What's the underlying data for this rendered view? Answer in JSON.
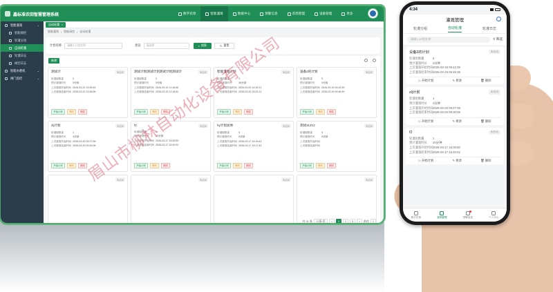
{
  "desktop": {
    "app_title": "鑫标准农田智慧管理系统",
    "topnav": [
      {
        "label": "数字农场",
        "active": false
      },
      {
        "label": "智能灌溉",
        "active": true
      },
      {
        "label": "数据中心",
        "active": false
      },
      {
        "label": "预警信息",
        "active": false
      },
      {
        "label": "农场管理",
        "active": false
      },
      {
        "label": "设备管理",
        "active": false
      },
      {
        "label": "更多",
        "active": false
      }
    ],
    "sidebar": [
      {
        "label": "智能灌溉",
        "type": "group"
      },
      {
        "label": "智能阀控",
        "type": "sub"
      },
      {
        "label": "轮灌分组",
        "type": "sub"
      },
      {
        "label": "自动轮灌",
        "type": "sub",
        "active": true
      },
      {
        "label": "轮灌日志",
        "type": "sub"
      },
      {
        "label": "阀控日志",
        "type": "sub"
      },
      {
        "label": "智能水肥机",
        "type": "group"
      },
      {
        "label": "闸门监控",
        "type": "group"
      }
    ],
    "tab_label": "自动轮灌",
    "breadcrumb": [
      "智能灌溉",
      "智能阀控",
      "自动轮灌"
    ],
    "filter": {
      "name_label": "计划名称",
      "name_placeholder": "请输入计划名称",
      "status_label": "状态",
      "status_placeholder": "请选择",
      "search_label": "搜索",
      "reset_label": "重置"
    },
    "add_label": "新增",
    "field_labels": {
      "count": "轮灌组数量",
      "duration": "预计灌溉时长",
      "last_start": "上次灌溉开始时间",
      "last_end": "上次灌溉结束时间"
    },
    "action_labels": {
      "start": "开始计划",
      "edit": "修改",
      "delete": "删除"
    },
    "cards": [
      {
        "name": "测试计",
        "status": "未启动",
        "count": "2",
        "duration": "0分钟",
        "last_start": "2026-03-20 13:35:45",
        "last_end": "2026-03-20 13:36:06"
      },
      {
        "name": "测试计划测试计划测试计划测试计",
        "status": "未启动",
        "count": "0",
        "duration": "0分钟",
        "last_start": "2026-03-19 11:18:48",
        "last_end": "2026-03-19 11:18:52"
      },
      {
        "name": "智能灌溉计划",
        "status": "未启动",
        "count": "3",
        "duration": "36分钟",
        "last_start": "2026-03-20 14:15:11",
        "last_end": "2026-03-20 15:22:12"
      },
      {
        "name": "设备2的计划",
        "status": "未启动",
        "count": "5",
        "duration": "0分钟",
        "last_start": "2026-03-19 09:42:39",
        "last_end": "2026-03-19 09:46:39"
      },
      {
        "name": "zlj计划",
        "status": "未启动",
        "count": "1",
        "duration": "3分钟",
        "last_start": "2026-03-20 09:27:08",
        "last_end": "2026-03-20 09:30:08"
      },
      {
        "name": "f2",
        "status": "未启动",
        "count": "1",
        "duration": "20分钟",
        "last_start": "2026-03-17 15:39:50",
        "last_end": "2026-03-17 15:40:02"
      },
      {
        "name": "hy计划总体",
        "status": "未启动",
        "count": "0",
        "duration": "0分钟",
        "last_start": "2026-03-17 16:15:43",
        "last_end": "2026-03-17 16:17:43"
      },
      {
        "name": "测试11212",
        "status": "未启动",
        "count": "0",
        "duration": "0分钟",
        "last_start": "",
        "last_end": ""
      },
      {
        "name": "",
        "status": "未启动",
        "count": "",
        "duration": "",
        "last_start": "",
        "last_end": ""
      },
      {
        "name": "",
        "status": "未启动",
        "count": "",
        "duration": "",
        "last_start": "",
        "last_end": ""
      },
      {
        "name": "",
        "status": "未启动",
        "count": "",
        "duration": "",
        "last_start": "",
        "last_end": ""
      },
      {
        "name": "",
        "status": "未启动",
        "count": "",
        "duration": "",
        "last_start": "",
        "last_end": ""
      }
    ],
    "pager": {
      "total": "共 31 条",
      "size": "12条/页",
      "prev": "<",
      "pages": [
        "1",
        "2",
        "3"
      ],
      "current": "1",
      "next": ">",
      "goto_label": "前往",
      "goto_value": "1"
    }
  },
  "watermark": "眉山市柳林自动化设备有限公司",
  "mobile": {
    "time": "4:34",
    "title": "灌溉管理",
    "tabs": [
      "轮灌分组",
      "自动轮灌",
      "轮灌日志"
    ],
    "active_tab": "自动轮灌",
    "search_placeholder": "请输入计划名称",
    "filter_label": "筛选",
    "field_labels": {
      "count": "轮灌组数量",
      "duration": "预计灌溉时长",
      "last_start": "上次灌溉开始时间",
      "last_end": "上次灌溉结束时间"
    },
    "action_labels": {
      "start": "开始计划",
      "edit": "修改",
      "delete": "删除"
    },
    "cards": [
      {
        "name": "设备2的计划",
        "status": "未启动",
        "count": "5",
        "duration": "0分钟",
        "last_start": "2026-03-19 09:42:39",
        "last_end": "2026-03-19 09:46:39"
      },
      {
        "name": "zlj计划",
        "status": "未启动",
        "count": "1",
        "duration": "3分钟",
        "last_start": "2026-03-20 09:27:08",
        "last_end": "2026-03-20 09:30:08"
      },
      {
        "name": "f2",
        "status": "未启动",
        "count": "1",
        "duration": "20分钟",
        "last_start": "2026-03-17 15:39:50",
        "last_end": "2026-03-17 15:40:02"
      }
    ],
    "bottom_nav": [
      {
        "label": "数字农场",
        "active": false
      },
      {
        "label": "灌溉管理",
        "active": true
      },
      {
        "label": "预警信息",
        "active": false
      },
      {
        "label": "个人中心",
        "active": false
      }
    ]
  },
  "colors": {
    "brand": "#1f8f57",
    "sidebar": "#2b3c4b",
    "edit": "#d98a1c",
    "delete": "#d9534f"
  }
}
